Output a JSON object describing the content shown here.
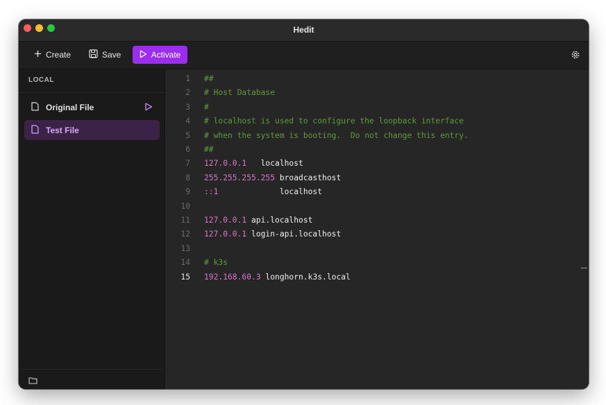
{
  "window": {
    "title": "Hedit"
  },
  "toolbar": {
    "create_label": "Create",
    "save_label": "Save",
    "activate_label": "Activate",
    "accent_color": "#9b2cf0"
  },
  "sidebar": {
    "header": "LOCAL",
    "items": [
      {
        "label": "Original File",
        "icon": "file-icon",
        "active": true
      },
      {
        "label": "Test File",
        "icon": "file-icon",
        "selected": true
      }
    ]
  },
  "editor": {
    "lines": [
      {
        "n": "1",
        "comment": "##"
      },
      {
        "n": "2",
        "comment": "# Host Database"
      },
      {
        "n": "3",
        "comment": "#"
      },
      {
        "n": "4",
        "comment": "# localhost is used to configure the loopback interface"
      },
      {
        "n": "5",
        "comment": "# when the system is booting.  Do not change this entry."
      },
      {
        "n": "6",
        "comment": "##"
      },
      {
        "n": "7",
        "ip": "127.0.0.1",
        "host": "   localhost"
      },
      {
        "n": "8",
        "ip": "255.255.255.255",
        "host": " broadcasthost"
      },
      {
        "n": "9",
        "ip": "::1",
        "host": "             localhost"
      },
      {
        "n": "10"
      },
      {
        "n": "11",
        "ip": "127.0.0.1",
        "host": " api.localhost"
      },
      {
        "n": "12",
        "ip": "127.0.0.1",
        "host": " login-api.localhost"
      },
      {
        "n": "13"
      },
      {
        "n": "14",
        "comment": "# k3s"
      },
      {
        "n": "15",
        "ip": "192.168.60.3",
        "host": " longhorn.k3s.local",
        "current": true
      }
    ]
  }
}
